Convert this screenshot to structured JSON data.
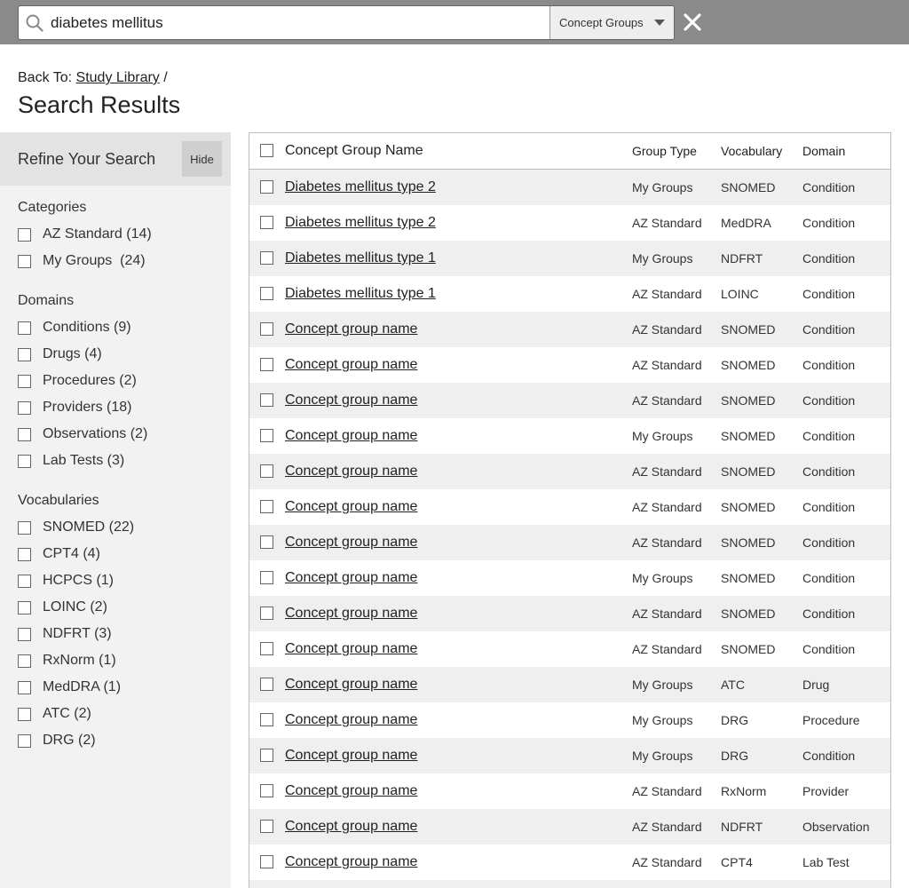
{
  "search": {
    "value": "diabetes mellitus",
    "scope": "Concept Groups"
  },
  "breadcrumb": {
    "prefix": "Back To:",
    "link": "Study Library",
    "separator": "/"
  },
  "page_title": "Search Results",
  "sidebar": {
    "title": "Refine Your Search",
    "hide_label": "Hide",
    "groups": [
      {
        "title": "Categories",
        "items": [
          "AZ Standard (14)",
          "My Groups  (24)"
        ]
      },
      {
        "title": "Domains",
        "items": [
          "Conditions (9)",
          "Drugs (4)",
          "Procedures (2)",
          "Providers (18)",
          "Observations (2)",
          "Lab Tests (3)"
        ]
      },
      {
        "title": "Vocabularies",
        "items": [
          "SNOMED (22)",
          "CPT4 (4)",
          "HCPCS (1)",
          "LOINC (2)",
          "NDFRT (3)",
          "RxNorm (1)",
          "MedDRA (1)",
          "ATC (2)",
          "DRG (2)"
        ]
      }
    ]
  },
  "table": {
    "headers": {
      "name": "Concept Group Name",
      "type": "Group Type",
      "vocab": "Vocabulary",
      "domain": "Domain"
    },
    "rows": [
      {
        "name": "Diabetes mellitus type 2",
        "type": "My Groups",
        "vocab": "SNOMED",
        "domain": "Condition"
      },
      {
        "name": "Diabetes mellitus type 2",
        "type": "AZ Standard",
        "vocab": "MedDRA",
        "domain": "Condition"
      },
      {
        "name": "Diabetes mellitus type 1",
        "type": "My Groups",
        "vocab": "NDFRT",
        "domain": "Condition"
      },
      {
        "name": "Diabetes mellitus type 1",
        "type": "AZ Standard",
        "vocab": "LOINC",
        "domain": "Condition"
      },
      {
        "name": "Concept group name",
        "type": "AZ Standard",
        "vocab": "SNOMED",
        "domain": "Condition"
      },
      {
        "name": "Concept group name",
        "type": "AZ Standard",
        "vocab": "SNOMED",
        "domain": "Condition"
      },
      {
        "name": "Concept group name",
        "type": "AZ Standard",
        "vocab": "SNOMED",
        "domain": "Condition"
      },
      {
        "name": "Concept group name",
        "type": "My Groups",
        "vocab": "SNOMED",
        "domain": "Condition"
      },
      {
        "name": "Concept group name",
        "type": "AZ Standard",
        "vocab": "SNOMED",
        "domain": "Condition"
      },
      {
        "name": "Concept group name",
        "type": "AZ Standard",
        "vocab": "SNOMED",
        "domain": "Condition"
      },
      {
        "name": "Concept group name",
        "type": "AZ Standard",
        "vocab": "SNOMED",
        "domain": "Condition"
      },
      {
        "name": "Concept group name",
        "type": "My Groups",
        "vocab": "SNOMED",
        "domain": "Condition"
      },
      {
        "name": "Concept group name",
        "type": "AZ Standard",
        "vocab": "SNOMED",
        "domain": "Condition"
      },
      {
        "name": "Concept group name",
        "type": "AZ Standard",
        "vocab": "SNOMED",
        "domain": "Condition"
      },
      {
        "name": "Concept group name",
        "type": "My Groups",
        "vocab": "ATC",
        "domain": "Drug"
      },
      {
        "name": "Concept group name",
        "type": "My Groups",
        "vocab": "DRG",
        "domain": "Procedure"
      },
      {
        "name": "Concept group name",
        "type": "My Groups",
        "vocab": "DRG",
        "domain": "Condition"
      },
      {
        "name": "Concept group name",
        "type": "AZ Standard",
        "vocab": "RxNorm",
        "domain": "Provider"
      },
      {
        "name": "Concept group name",
        "type": "AZ Standard",
        "vocab": "NDFRT",
        "domain": "Observation"
      },
      {
        "name": "Concept group name",
        "type": "AZ Standard",
        "vocab": "CPT4",
        "domain": "Lab Test"
      },
      {
        "name": "",
        "type": "",
        "vocab": "",
        "domain": ""
      }
    ]
  }
}
